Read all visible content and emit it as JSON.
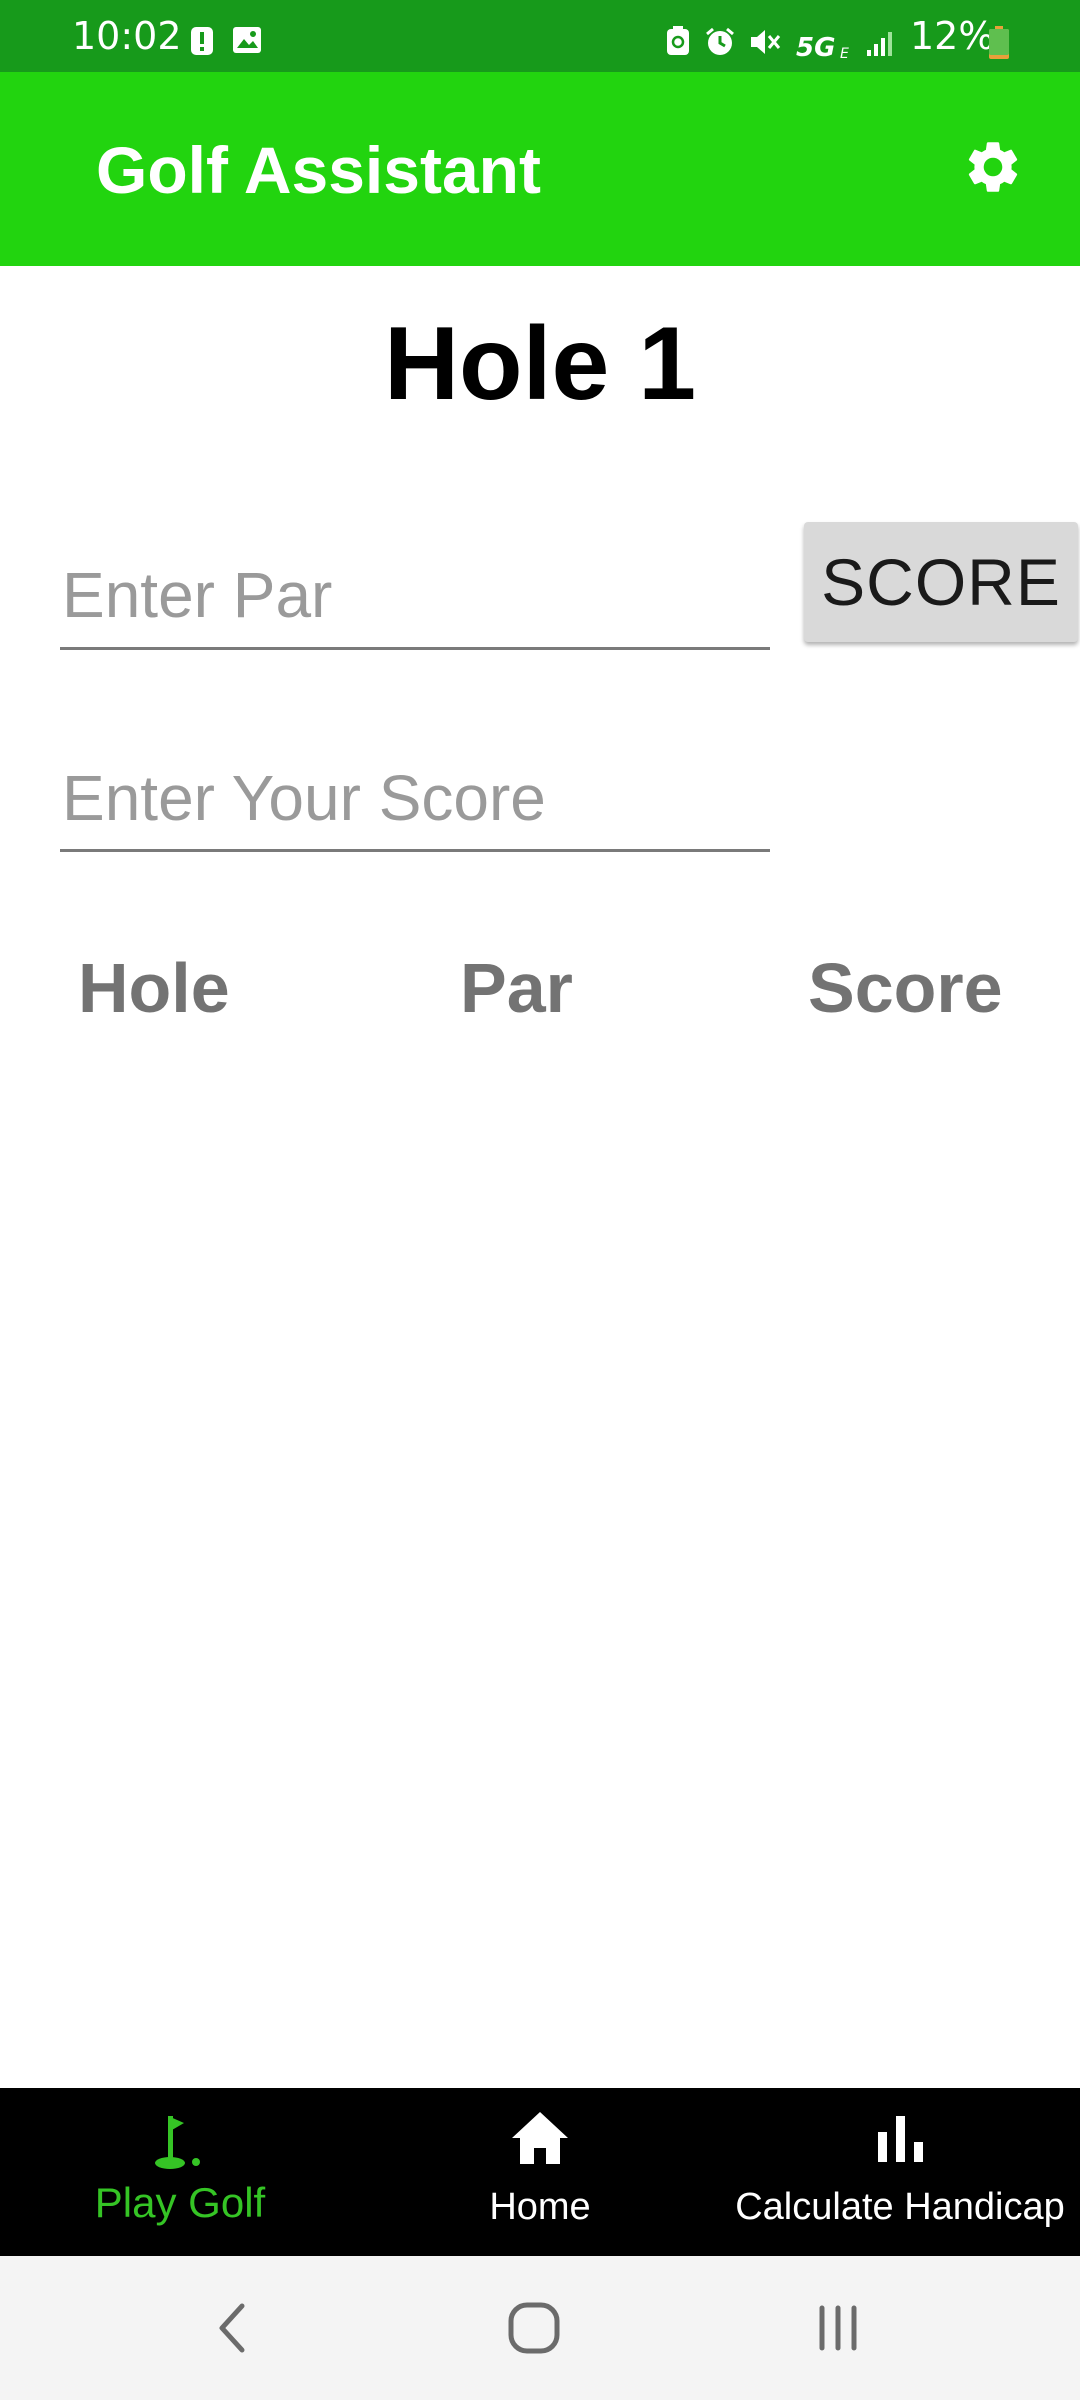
{
  "status_bar": {
    "time": "10:02",
    "battery": "12%",
    "network": "5G E",
    "left_icons": [
      "alert-icon",
      "image-icon"
    ],
    "right_icons": [
      "recycle-icon",
      "alarm-icon",
      "mute-icon",
      "5g-icon",
      "signal-icon",
      "battery-icon"
    ]
  },
  "app_bar": {
    "title": "Golf Assistant",
    "settings_icon": "gear-icon"
  },
  "main": {
    "hole_title": "Hole 1",
    "par_placeholder": "Enter Par",
    "par_value": "",
    "score_placeholder": "Enter Your Score",
    "score_value": "",
    "score_button": "SCORE",
    "table_headers": [
      "Hole",
      "Par",
      "Score"
    ],
    "table_rows": []
  },
  "bottom_nav": {
    "items": [
      {
        "label": "Play Golf",
        "icon": "golf-flag-icon",
        "active": true
      },
      {
        "label": "Home",
        "icon": "home-icon",
        "active": false
      },
      {
        "label": "Calculate Handicap",
        "icon": "bar-chart-icon",
        "active": false
      }
    ]
  },
  "system_nav": [
    "back-icon",
    "home-circle-icon",
    "recents-icon"
  ],
  "colors": {
    "status_bar": "#179a1b",
    "app_bar": "#22d40f",
    "active_nav": "#35c425",
    "nav_background": "#000000"
  }
}
